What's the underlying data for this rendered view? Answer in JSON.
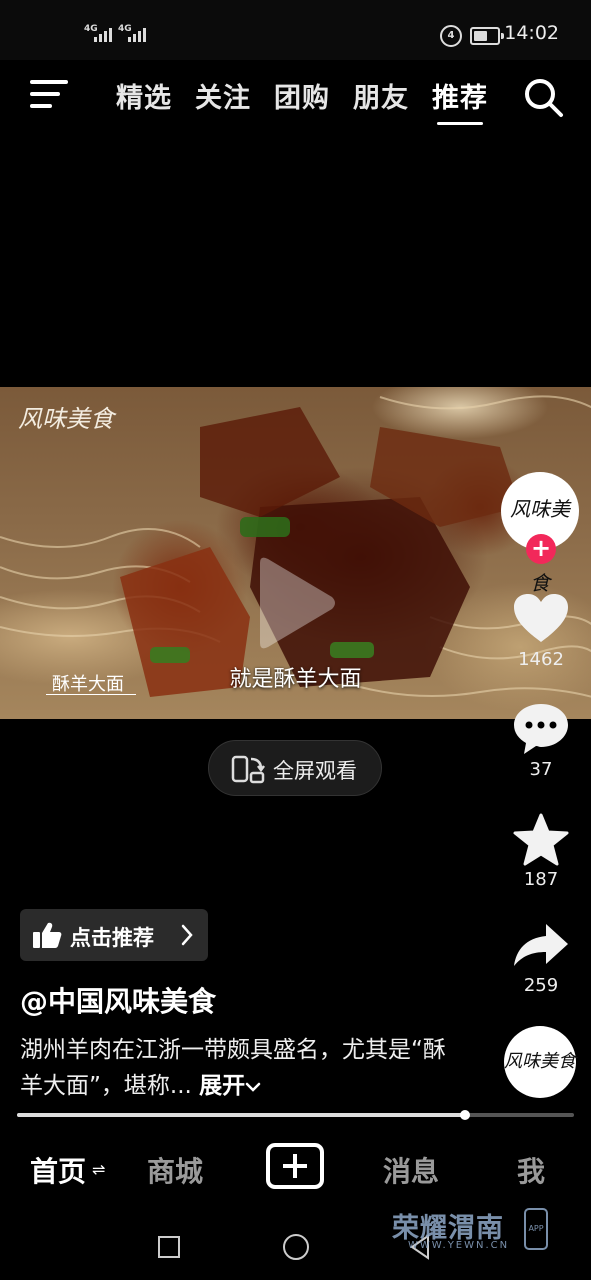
{
  "status_bar": {
    "signal_1": "4G",
    "signal_2": "4G",
    "time": "14:02",
    "battery_level": 0.6
  },
  "top_nav": {
    "tabs": [
      {
        "label": "精选",
        "active": false
      },
      {
        "label": "关注",
        "active": false
      },
      {
        "label": "团购",
        "active": false
      },
      {
        "label": "朋友",
        "active": false
      },
      {
        "label": "推荐",
        "active": true
      }
    ],
    "menu_icon": "menu-icon",
    "search_icon": "search-icon"
  },
  "video": {
    "logo_text": "风味美食",
    "dish_name": "酥羊大面",
    "caption": "就是酥羊大面"
  },
  "fullscreen_button": {
    "label": "全屏观看",
    "icon": "rotate-screen-icon"
  },
  "actions": {
    "author_avatar_text": "风味美食",
    "likes": "1462",
    "comments": "37",
    "favorites": "187",
    "shares": "259"
  },
  "post": {
    "recommend_chip": "点击推荐",
    "username": "@中国风味美食",
    "description": "湖州羊肉在江浙一带颇具盛名，尤其是“酥羊大面”，堪称...",
    "expand_label": "展开",
    "music_disc_text": "风味美食",
    "progress": 0.805
  },
  "bottom_tabs": [
    {
      "label": "首页",
      "active": true
    },
    {
      "label": "商城",
      "active": false
    },
    {
      "label": "消息",
      "active": false
    },
    {
      "label": "我",
      "active": false
    }
  ],
  "watermark": {
    "title": "荣耀渭南",
    "url": "WWW.YEWN.CN",
    "app": "APP"
  },
  "colors": {
    "follow": "#f2285a",
    "background": "#000000"
  }
}
